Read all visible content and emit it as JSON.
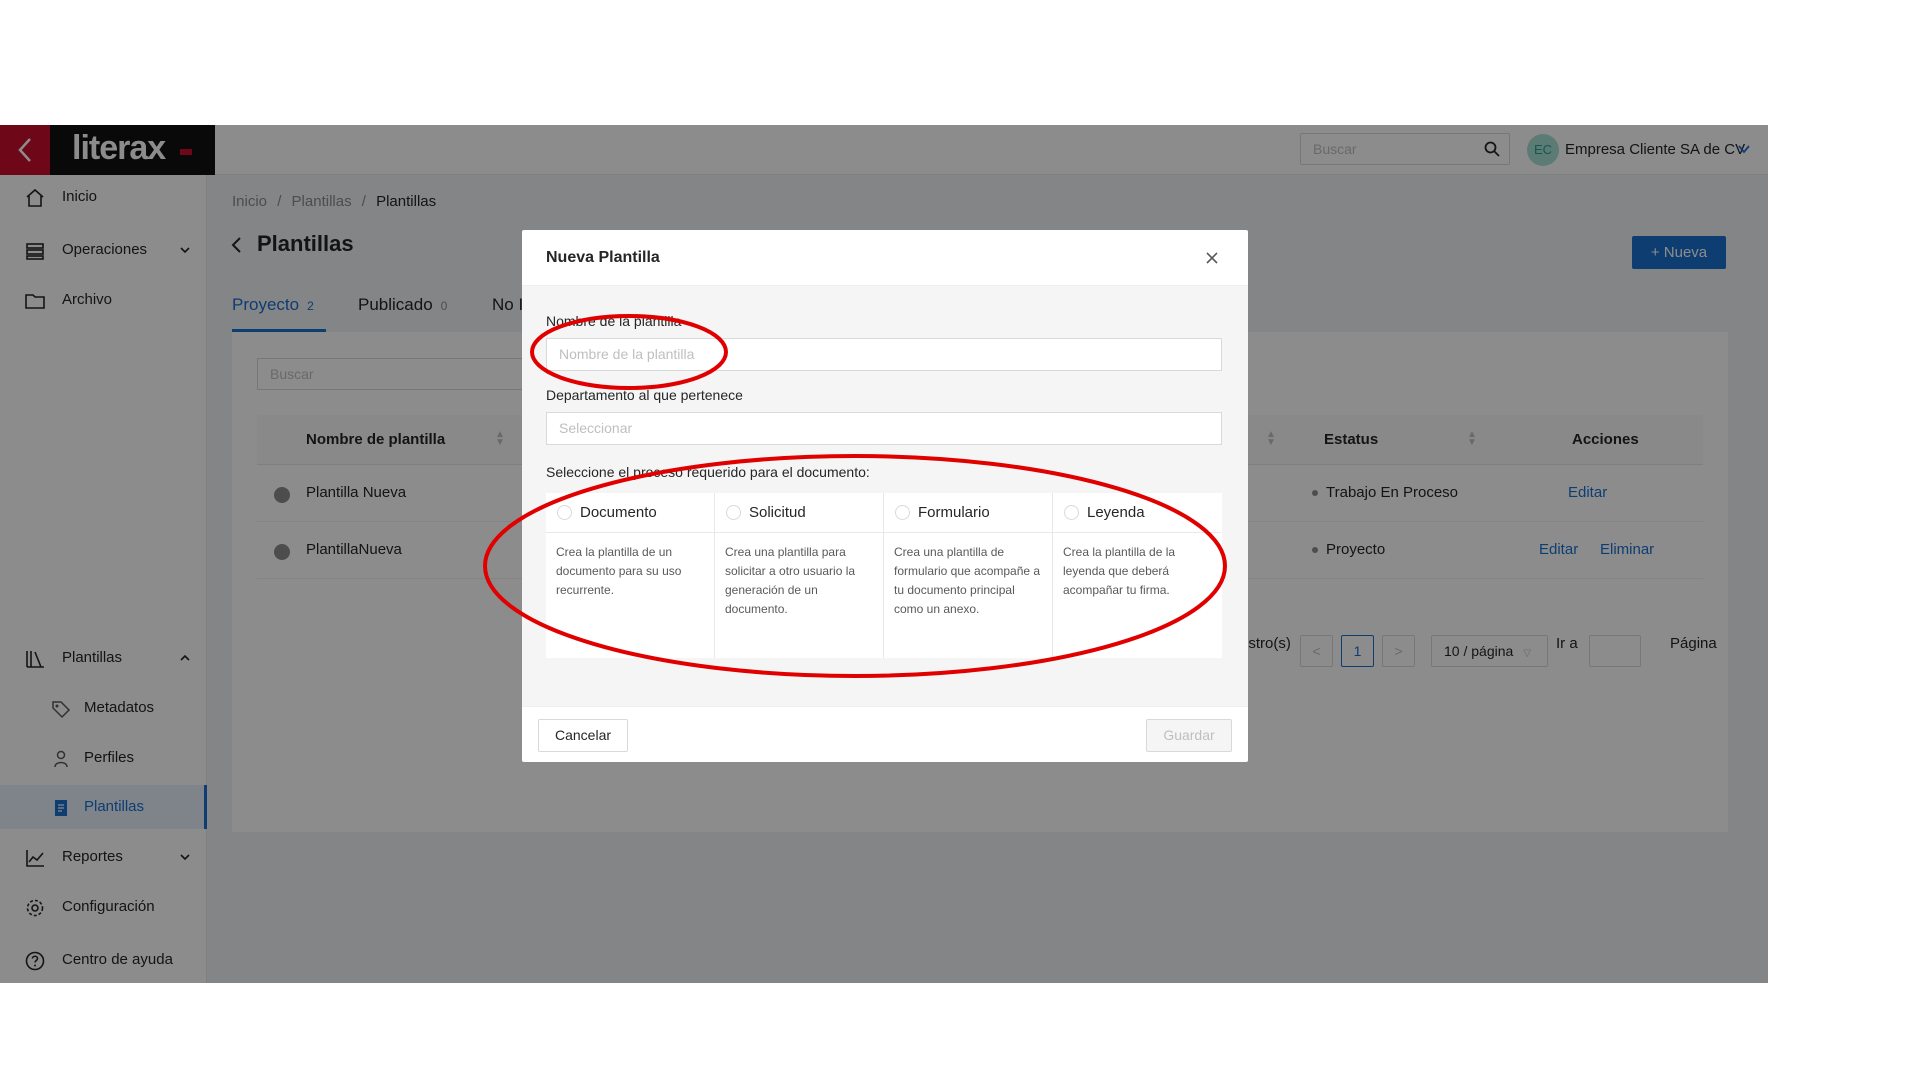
{
  "brand": {
    "logo_text": "literax",
    "accent_color": "#c8102e",
    "primary_color": "#1a6fd0"
  },
  "header": {
    "search_placeholder": "Buscar",
    "avatar_initials": "EC",
    "company": "Empresa Cliente SA de CV"
  },
  "sidebar": {
    "items": [
      {
        "label": "Inicio",
        "icon": "home-icon"
      },
      {
        "label": "Operaciones",
        "icon": "operations-icon"
      },
      {
        "label": "Archivo",
        "icon": "folder-icon"
      },
      {
        "label": "Plantillas",
        "icon": "library-icon"
      },
      {
        "label": "Metadatos",
        "icon": "tag-icon"
      },
      {
        "label": "Perfiles",
        "icon": "profile-icon"
      },
      {
        "label": "Plantillas",
        "icon": "document-icon",
        "active": true
      },
      {
        "label": "Reportes",
        "icon": "chart-icon"
      },
      {
        "label": "Configuración",
        "icon": "gear-icon"
      },
      {
        "label": "Centro de ayuda",
        "icon": "help-icon"
      }
    ]
  },
  "breadcrumb": [
    "Inicio",
    "/",
    "Plantillas",
    "/",
    "Plantillas"
  ],
  "page": {
    "title": "Plantillas",
    "new_button": "+ Nueva",
    "tabs": [
      {
        "label": "Proyecto",
        "count": "2"
      },
      {
        "label": "Publicado",
        "count": "0"
      },
      {
        "label": "No I",
        "count": ""
      }
    ],
    "list_search_placeholder": "Buscar",
    "columns": {
      "name": "Nombre de plantilla",
      "status": "Estatus",
      "actions": "Acciones"
    },
    "rows": [
      {
        "name": "Plantilla Nueva",
        "status": "Trabajo En Proceso",
        "edit": "Editar",
        "delete": ""
      },
      {
        "name": "PlantillaNueva",
        "status": "Proyecto",
        "edit": "Editar",
        "delete": "Eliminar"
      }
    ],
    "pagination": {
      "total_fragment": "istro(s)",
      "prev": "<",
      "current": "1",
      "next": ">",
      "page_size": "10 / página",
      "goto_label": "Ir a",
      "page_label": "Página"
    }
  },
  "modal": {
    "title": "Nueva Plantilla",
    "name_label": "Nombre de la plantilla",
    "name_placeholder": "Nombre de la plantilla",
    "dept_label": "Departamento al que pertenece",
    "dept_placeholder": "Seleccionar",
    "process_label": "Seleccione el proceso requerido para el documento:",
    "options": [
      {
        "name": "Documento",
        "desc": "Crea la plantilla de un documento para su uso recurrente."
      },
      {
        "name": "Solicitud",
        "desc": "Crea una plantilla para solicitar a otro usuario la generación de un documento."
      },
      {
        "name": "Formulario",
        "desc": "Crea una plantilla de formulario que acompañe a tu documento principal como un anexo."
      },
      {
        "name": "Leyenda",
        "desc": "Crea la plantilla de la leyenda que deberá acompañar tu firma."
      }
    ],
    "cancel": "Cancelar",
    "save": "Guardar"
  },
  "annotations": {
    "color": "#e00000"
  }
}
